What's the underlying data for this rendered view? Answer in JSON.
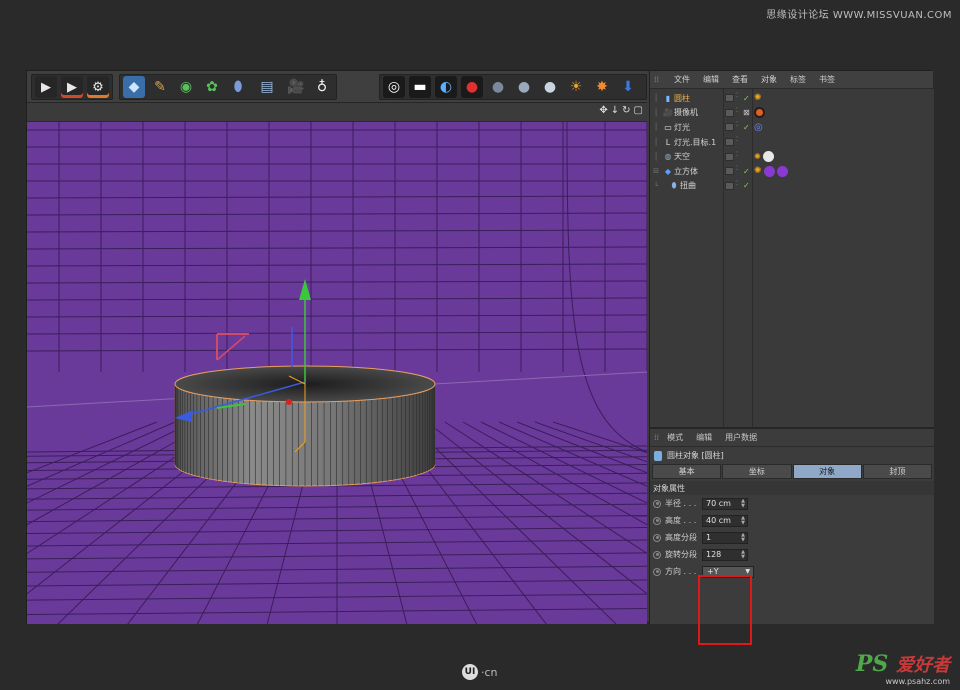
{
  "watermark_top": "思缘设计论坛 WWW.MISSVUAN.COM",
  "toolbar": {
    "render_icons": [
      "render-view-icon",
      "render-picture-viewer-icon",
      "render-settings-icon"
    ],
    "object_icons": [
      "cube-icon",
      "pen-spline-icon",
      "generator-icon",
      "array-icon",
      "deformer-icon",
      "floor-grid-icon",
      "camera-icon",
      "light-bulb-icon"
    ],
    "material_icons": [
      "bullseye-icon",
      "wide-light-icon",
      "contrast-icon",
      "record-icon",
      "sphere-dark-icon",
      "sphere-mid-icon",
      "sphere-light-icon",
      "sun-xyz-icon",
      "burst-icon",
      "merge-arrow-icon"
    ]
  },
  "viewport": {
    "nav_icons": [
      "move-view-icon",
      "down-arrow-icon",
      "rotate-view-icon",
      "maximize-icon"
    ],
    "colors": {
      "background": "#6a3a9a",
      "grid": "#3a1e5a"
    }
  },
  "object_manager": {
    "menu": [
      "文件",
      "编辑",
      "查看",
      "对象",
      "标签",
      "书签"
    ],
    "objects": [
      {
        "name": "圆柱",
        "icon": "cylinder-icon",
        "selected": true,
        "tag": "sun-tag-icon"
      },
      {
        "name": "摄像机",
        "icon": "camera-icon",
        "selected": false,
        "tag": "camera-tag-icon"
      },
      {
        "name": "灯光",
        "icon": "light-icon",
        "selected": false,
        "tag": "target-tag-icon"
      },
      {
        "name": "灯光.目标.1",
        "icon": "light-target-icon",
        "selected": false,
        "tag": ""
      },
      {
        "name": "天空",
        "icon": "sky-icon",
        "selected": false,
        "tag": "sky-material-tag-icon"
      },
      {
        "name": "立方体",
        "icon": "cube-icon",
        "selected": false,
        "tag": "cube-material-tag-icon"
      },
      {
        "name": "扭曲",
        "icon": "bend-icon",
        "selected": false,
        "tag": ""
      }
    ]
  },
  "attribute_manager": {
    "menu": [
      "模式",
      "编辑",
      "用户数据"
    ],
    "title": "圆柱对象 [圆柱]",
    "tabs": [
      "基本",
      "坐标",
      "对象",
      "封顶"
    ],
    "active_tab": "对象",
    "section": "对象属性",
    "params": [
      {
        "label": "半径 . . .",
        "value": "70 cm"
      },
      {
        "label": "高度 . . .",
        "value": "40 cm"
      },
      {
        "label": "高度分段",
        "value": "1"
      },
      {
        "label": "旋转分段",
        "value": "128"
      }
    ],
    "direction": {
      "label": "方向 . . .",
      "value": "+Y"
    }
  },
  "footer": {
    "ui_logo": "UI",
    "ui_domain": "·cn",
    "ps_brand": "PS",
    "ps_cn": "爱好者",
    "ps_url": "www.psahz.com"
  },
  "accent_colors": {
    "selected_text": "#f2b54a",
    "highlight": "#e01818",
    "active_tab": "#8fa8c8"
  }
}
